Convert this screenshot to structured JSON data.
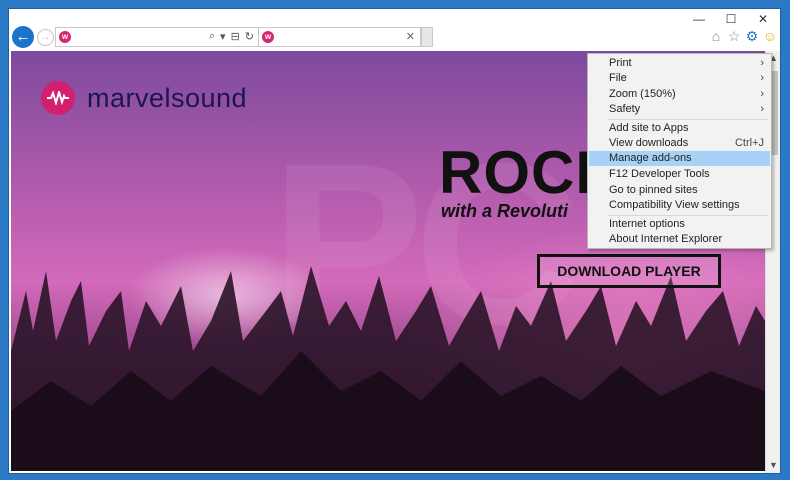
{
  "caption": {
    "minimize": "—",
    "maximize": "☐",
    "close": "✕"
  },
  "nav": {
    "back_icon": "←",
    "forward_icon": "→",
    "favicon_glyph": "w",
    "address_value": "",
    "address_tools": {
      "search": "⌕",
      "dropdown": "▾",
      "compat": "⊟",
      "refresh": "↻"
    },
    "tab_title": "",
    "tab_close": "✕"
  },
  "toolbar": {
    "home_icon": "⌂",
    "favorites_icon": "☆",
    "tools_icon": "⚙",
    "smile_icon": "☺"
  },
  "site": {
    "logo_text": "marvelsound",
    "headline": "ROCK",
    "subline": "with a Revoluti",
    "download_label": "DOWNLOAD PLAYER"
  },
  "scrollbar": {
    "up": "▲",
    "down": "▼"
  },
  "menu": {
    "items": [
      {
        "label": "Print",
        "arrow": "›"
      },
      {
        "label": "File",
        "arrow": "›"
      },
      {
        "label": "Zoom (150%)",
        "arrow": "›"
      },
      {
        "label": "Safety",
        "arrow": "›"
      },
      {
        "label": "Add site to Apps"
      },
      {
        "label": "View downloads",
        "shortcut": "Ctrl+J"
      },
      {
        "label": "Manage add-ons",
        "highlighted": true
      },
      {
        "label": "F12 Developer Tools"
      },
      {
        "label": "Go to pinned sites"
      },
      {
        "label": "Compatibility View settings"
      },
      {
        "label": "Internet options"
      },
      {
        "label": "About Internet Explorer"
      }
    ]
  },
  "colors": {
    "accent": "#1d73c9",
    "brand": "#d31f6e",
    "highlight": "#a8d1f7"
  }
}
